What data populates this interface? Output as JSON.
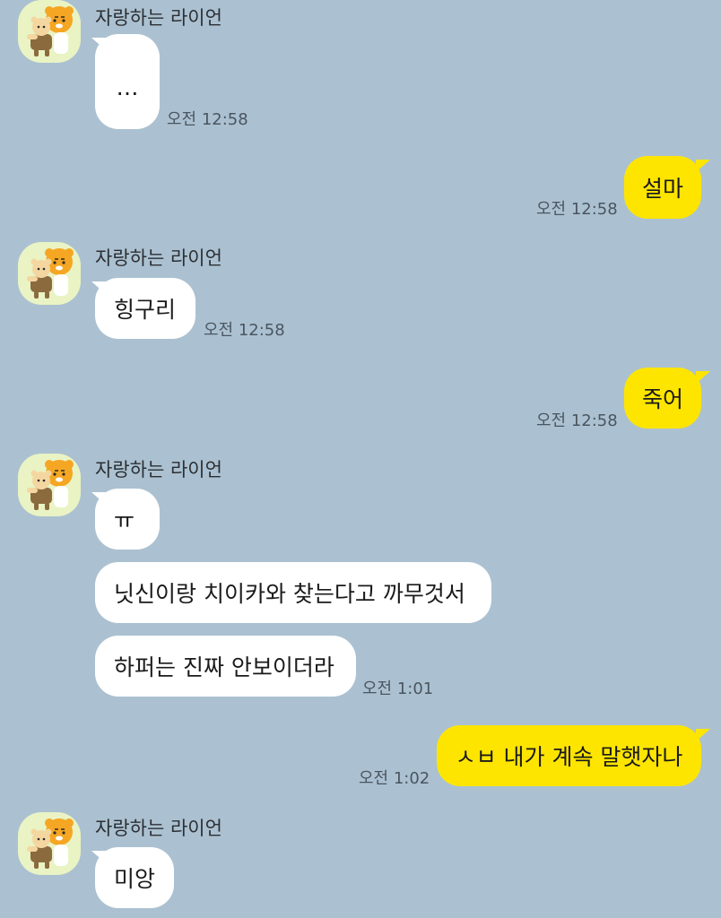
{
  "chat": {
    "sender_name": "자랑하는 라이언",
    "messages": [
      {
        "text": "…",
        "time": "오전 12:58"
      },
      {
        "text": "설마",
        "time": "오전 12:58"
      },
      {
        "text": "힝구리",
        "time": "오전 12:58"
      },
      {
        "text": "죽어",
        "time": "오전 12:58"
      },
      {
        "text": "ㅠ"
      },
      {
        "text": "닛신이랑 치이카와 찾는다고 까무것서"
      },
      {
        "text": "하퍼는 진짜 안보이더라",
        "time": "오전 1:01"
      },
      {
        "text": "ㅅㅂ 내가 계속 말햇자나",
        "time": "오전 1:02"
      },
      {
        "text": "미앙"
      }
    ]
  },
  "icons": {
    "avatar": "ryan-lion-icon"
  },
  "colors": {
    "background": "#abc1d1",
    "incoming_bubble": "#ffffff",
    "outgoing_bubble": "#fee500",
    "avatar_background": "#e9f3c4"
  }
}
